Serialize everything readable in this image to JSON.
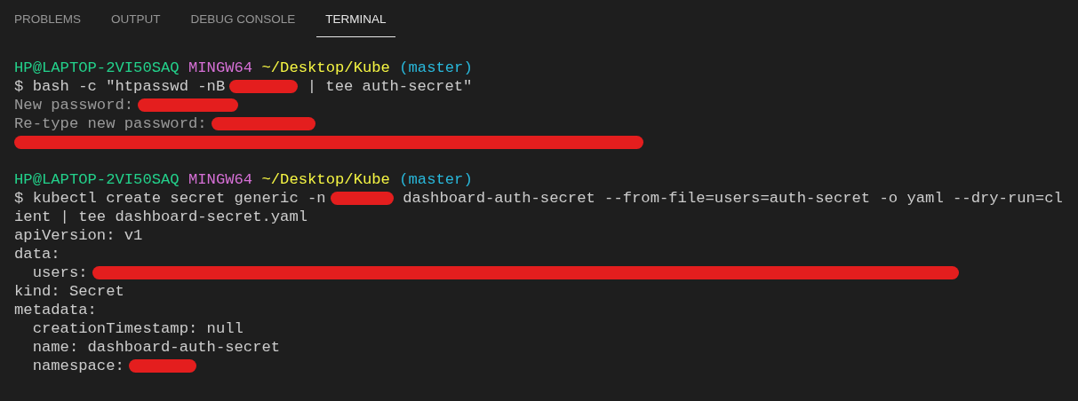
{
  "tabs": [
    {
      "label": "PROBLEMS",
      "selected": false
    },
    {
      "label": "OUTPUT",
      "selected": false
    },
    {
      "label": "DEBUG CONSOLE",
      "selected": false
    },
    {
      "label": "TERMINAL",
      "selected": true
    }
  ],
  "terminal": {
    "blocks": [
      {
        "lines": [
          {
            "indented": false,
            "segments": [
              {
                "kind": "user",
                "text": "HP@LAPTOP-2VI50SAQ"
              },
              {
                "kind": "shell",
                "text": "MINGW64"
              },
              {
                "kind": "path",
                "text": "~/Desktop/Kube"
              },
              {
                "kind": "branch",
                "text": "(master)"
              }
            ]
          },
          {
            "indented": false,
            "segments": [
              {
                "kind": "command",
                "text": "$ bash -c \"htpasswd -nB"
              },
              {
                "kind": "redaction"
              },
              {
                "kind": "command",
                "text": "| tee auth-secret\""
              }
            ]
          },
          {
            "indented": false,
            "segments": [
              {
                "kind": "dim",
                "text": "New password:"
              },
              {
                "kind": "redaction"
              }
            ]
          },
          {
            "indented": false,
            "segments": [
              {
                "kind": "dim",
                "text": "Re-type new password:"
              },
              {
                "kind": "redaction"
              }
            ]
          },
          {
            "indented": false,
            "segments": [
              {
                "kind": "redaction"
              }
            ]
          }
        ]
      },
      {
        "lines": [
          {
            "indented": false,
            "segments": [
              {
                "kind": "user",
                "text": "HP@LAPTOP-2VI50SAQ"
              },
              {
                "kind": "shell",
                "text": "MINGW64"
              },
              {
                "kind": "path",
                "text": "~/Desktop/Kube"
              },
              {
                "kind": "branch",
                "text": "(master)"
              }
            ]
          },
          {
            "indented": false,
            "segments": [
              {
                "kind": "command",
                "text": "$ kubectl create secret generic -n"
              },
              {
                "kind": "redaction"
              },
              {
                "kind": "command",
                "text": "dashboard-auth-secret --from-file=users=auth-secret -o yaml --dry-run=cl"
              }
            ]
          },
          {
            "indented": false,
            "segments": [
              {
                "kind": "command",
                "text": "ient | tee dashboard-secret.yaml"
              }
            ]
          },
          {
            "indented": false,
            "segments": [
              {
                "kind": "output",
                "text": "apiVersion: v1"
              }
            ]
          },
          {
            "indented": false,
            "segments": [
              {
                "kind": "output",
                "text": "data:"
              }
            ]
          },
          {
            "indented": true,
            "segments": [
              {
                "kind": "output",
                "text": "users:"
              },
              {
                "kind": "redaction"
              }
            ]
          },
          {
            "indented": false,
            "segments": [
              {
                "kind": "output",
                "text": "kind: Secret"
              }
            ]
          },
          {
            "indented": false,
            "segments": [
              {
                "kind": "output",
                "text": "metadata:"
              }
            ]
          },
          {
            "indented": true,
            "segments": [
              {
                "kind": "output",
                "text": "creationTimestamp: null"
              }
            ]
          },
          {
            "indented": true,
            "segments": [
              {
                "kind": "output",
                "text": "name: dashboard-auth-secret"
              }
            ]
          },
          {
            "indented": true,
            "segments": [
              {
                "kind": "output",
                "text": "namespace:"
              },
              {
                "kind": "redaction"
              }
            ]
          }
        ]
      }
    ]
  }
}
